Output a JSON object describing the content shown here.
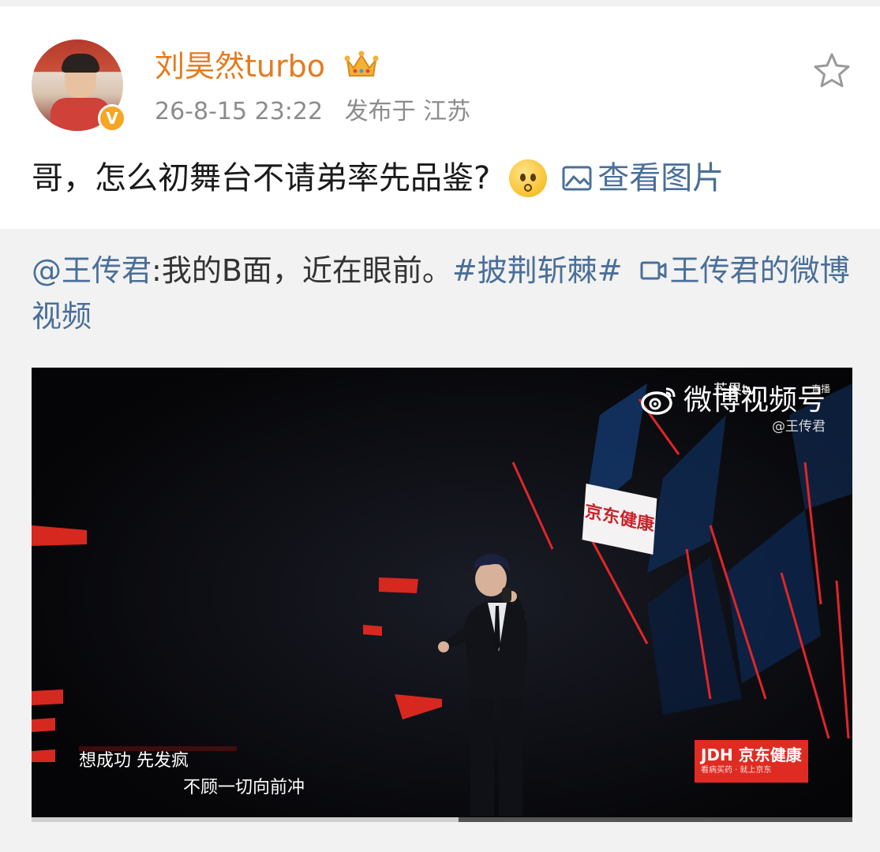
{
  "post": {
    "username": "刘昊然turbo",
    "timestamp": "26-8-15 23:22",
    "location": "发布于 江苏",
    "text": "哥，怎么初舞台不请弟率先品鉴?",
    "emoji": "upside-down-face",
    "view_image_label": "查看图片",
    "verified_badge": "V",
    "icons": {
      "crown": "crown-icon",
      "star": "star-icon",
      "image": "image-icon"
    }
  },
  "repost": {
    "mention": "@王传君",
    "text": ":我的B面，近在眼前。",
    "hashtag": "#披荆斩棘#",
    "video_link": "王传君的微博视频",
    "video": {
      "watermark": "微博视频号",
      "watermark_top": "芒果tv",
      "watermark_live": "直播",
      "watermark_user": "@王传君",
      "stage_sign": "京东健康",
      "lyric_line1": "想成功 先发疯",
      "lyric_line2": "不顾一切向前冲",
      "sponsor_top": "JDH 京东健康",
      "sponsor_bottom": "看病买药 · 就上京东",
      "progress": 0.52
    }
  },
  "colors": {
    "username": "#e37c1f",
    "link": "#4a6f99",
    "badge": "#f5a623",
    "sponsor": "#e02b22"
  }
}
